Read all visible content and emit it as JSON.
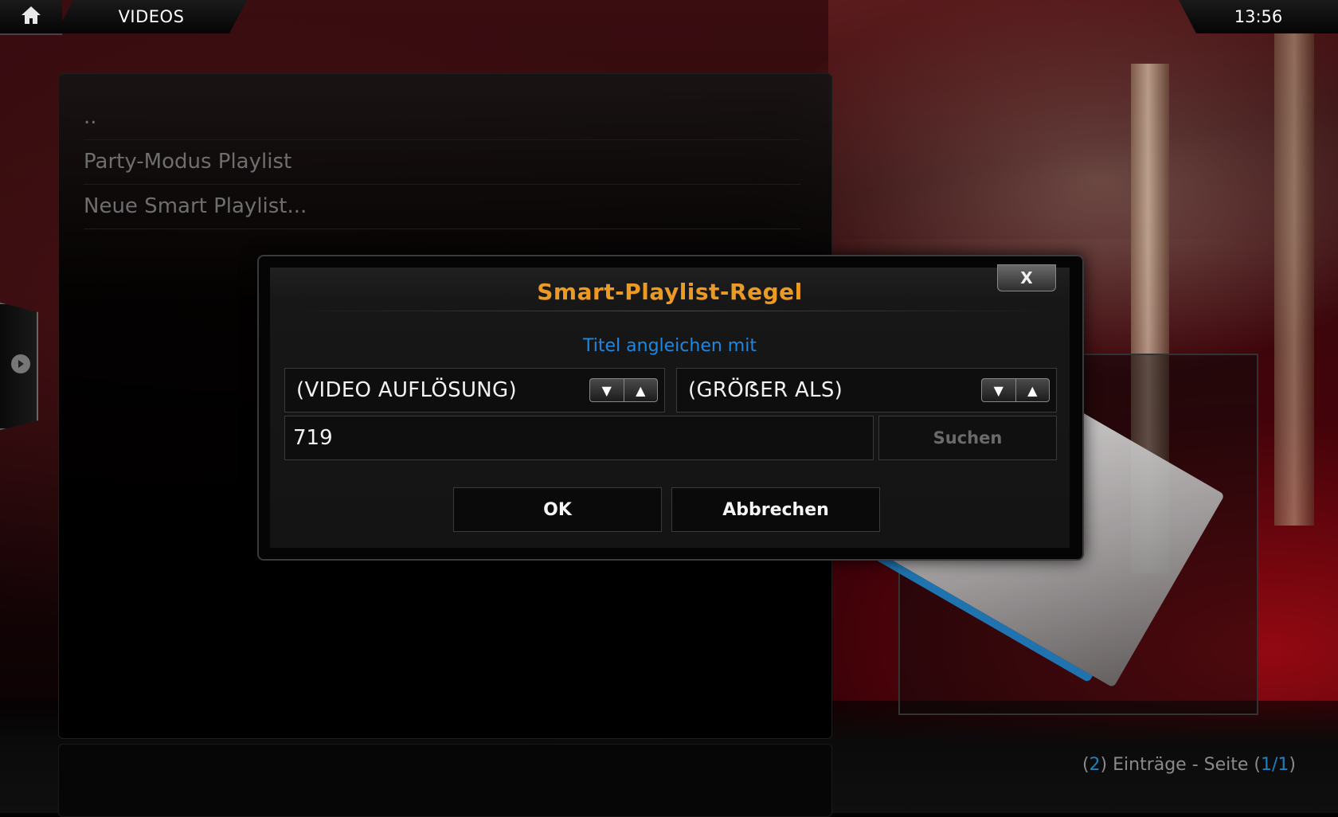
{
  "header": {
    "home_icon": "home-icon",
    "section_title": "VIDEOS",
    "clock": "13:56"
  },
  "list": {
    "items": [
      {
        "label": ".."
      },
      {
        "label": "Party-Modus Playlist"
      },
      {
        "label": "Neue Smart Playlist..."
      }
    ]
  },
  "footer": {
    "count_prefix": "(",
    "count": "2",
    "count_mid": ") Einträge - Seite (",
    "page": "1/1",
    "count_suffix": ")"
  },
  "dialog": {
    "title": "Smart-Playlist-Regel",
    "subtitle": "Titel angleichen mit",
    "close_label": "X",
    "field_select": "(VIDEO AUFLÖSUNG)",
    "operator_select": "(GRÖẞER ALS)",
    "value_input": "719",
    "search_label": "Suchen",
    "ok_label": "OK",
    "cancel_label": "Abbrechen",
    "spin_down_icon": "arrow-down-icon",
    "spin_up_icon": "arrow-up-icon"
  },
  "colors": {
    "title_accent": "#ec9a22",
    "subtitle_blue": "#1e87e0",
    "footer_number_blue": "#1e7fc0"
  }
}
